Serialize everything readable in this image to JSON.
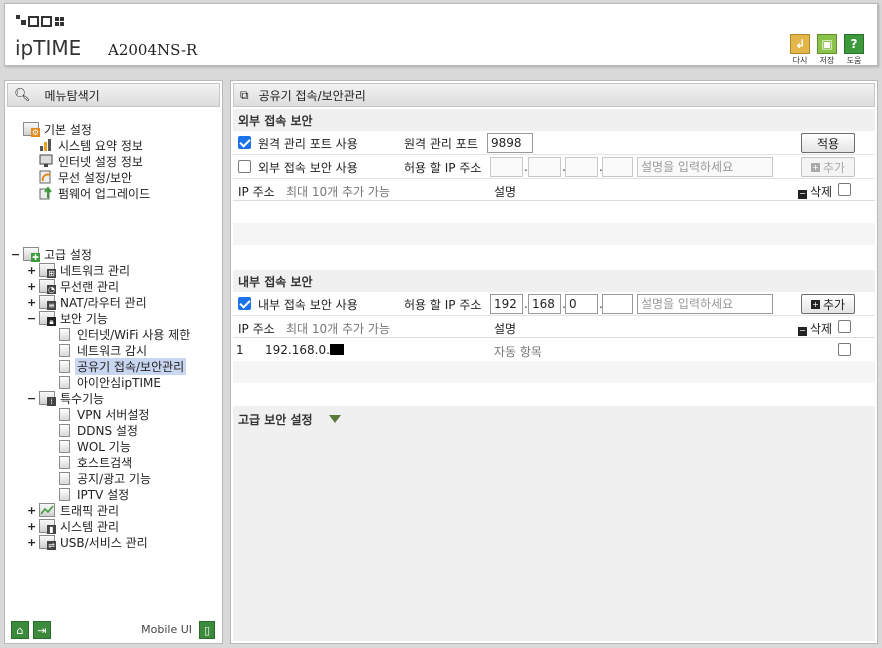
{
  "header": {
    "brand": "ipTIME",
    "model": "A2004NS-R",
    "buttons": [
      {
        "label": "다시",
        "icon": "refresh-icon",
        "color": "#e4b64a"
      },
      {
        "label": "저장",
        "icon": "save-icon",
        "color": "#8bc34a"
      },
      {
        "label": "도움",
        "icon": "help-icon",
        "color": "#3c9a3c"
      }
    ]
  },
  "sidebar": {
    "title": "메뉴탐색기",
    "basic": {
      "label": "기본 설정",
      "items": [
        "시스템 요약 정보",
        "인터넷 설정 정보",
        "무선 설정/보안",
        "펌웨어 업그레이드"
      ]
    },
    "advanced": {
      "label": "고급 설정",
      "groups": [
        {
          "label": "네트워크 관리",
          "pm": "+"
        },
        {
          "label": "무선랜 관리",
          "pm": "+"
        },
        {
          "label": "NAT/라우터 관리",
          "pm": "+"
        },
        {
          "label": "보안 기능",
          "pm": "−",
          "children": [
            "인터넷/WiFi 사용 제한",
            "네트워크 감시",
            "공유기 접속/보안관리",
            "아이안심ipTIME"
          ]
        },
        {
          "label": "특수기능",
          "pm": "−",
          "children": [
            "VPN 서버설정",
            "DDNS 설정",
            "WOL 기능",
            "호스트검색",
            "공지/광고 기능",
            "IPTV 설정"
          ]
        },
        {
          "label": "트래픽 관리",
          "pm": "+"
        },
        {
          "label": "시스템 관리",
          "pm": "+"
        },
        {
          "label": "USB/서비스 관리",
          "pm": "+"
        }
      ]
    },
    "footer": {
      "mobile_ui": "Mobile UI"
    }
  },
  "main": {
    "title": "공유기 접속/보안관리",
    "external": {
      "section_title": "외부 접속 보안",
      "remote_port_checkbox": "원격 관리 포트 사용",
      "remote_port_checked": true,
      "remote_port_label": "원격 관리 포트",
      "remote_port_value": "9898",
      "apply_button": "적용",
      "external_security_checkbox": "외부 접속 보안 사용",
      "external_security_checked": false,
      "allow_ip_label": "허용 할 IP 주소",
      "ip": [
        "",
        "",
        "",
        ""
      ],
      "desc_placeholder": "설명을 입력하세요",
      "add_button": "추가",
      "table": {
        "col_ip": "IP 주소",
        "col_ip_note": "최대 10개 추가 가능",
        "col_desc": "설명",
        "delete": "삭제"
      }
    },
    "internal": {
      "section_title": "내부 접속 보안",
      "internal_security_checkbox": "내부 접속 보안 사용",
      "internal_security_checked": true,
      "allow_ip_label": "허용 할 IP 주소",
      "ip": [
        "192",
        "168",
        "0",
        ""
      ],
      "desc_placeholder": "설명을 입력하세요",
      "add_button": "추가",
      "table": {
        "col_ip": "IP 주소",
        "col_ip_note": "최대 10개 추가 가능",
        "col_desc": "설명",
        "delete": "삭제"
      },
      "rows": [
        {
          "index": "1",
          "ip": "192.168.0.",
          "desc": "자동 항목"
        }
      ]
    },
    "advanced": {
      "title": "고급 보안 설정"
    }
  }
}
